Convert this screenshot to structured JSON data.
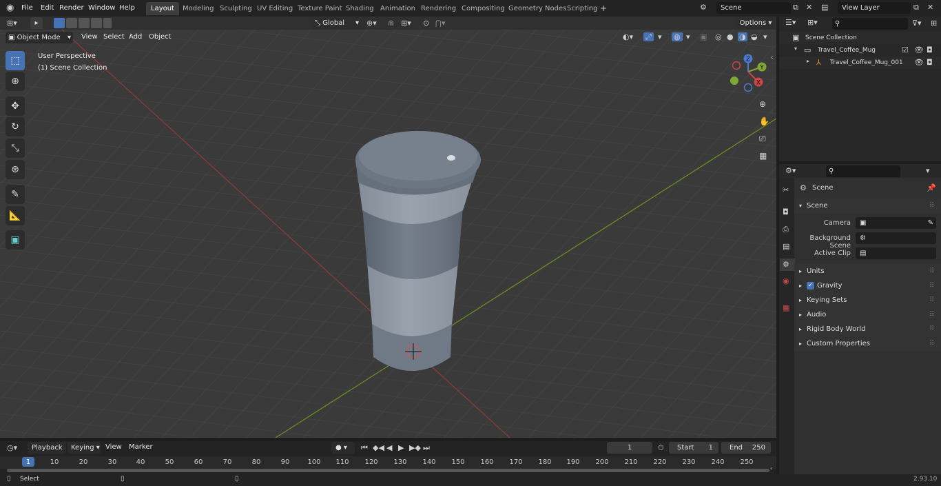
{
  "menus": [
    "File",
    "Edit",
    "Render",
    "Window",
    "Help"
  ],
  "workspaces": [
    "Layout",
    "Modeling",
    "Sculpting",
    "UV Editing",
    "Texture Paint",
    "Shading",
    "Animation",
    "Rendering",
    "Compositing",
    "Geometry Nodes",
    "Scripting"
  ],
  "active_workspace": "Layout",
  "scene_field": "Scene",
  "view_layer_field": "View Layer",
  "viewport": {
    "mode": "Object Mode",
    "menu": [
      "View",
      "Select",
      "Add",
      "Object"
    ],
    "transform_orientation": "Global",
    "options_label": "Options",
    "overlay_title": "User Perspective",
    "overlay_collection": "(1) Scene Collection",
    "gizmo_axes": {
      "x": "X",
      "y": "Y",
      "z": "Z"
    }
  },
  "outliner": {
    "root": "Scene Collection",
    "items": [
      {
        "label": "Travel_Coffee_Mug"
      },
      {
        "label": "Travel_Coffee_Mug_001"
      }
    ]
  },
  "properties": {
    "breadcrumb": "Scene",
    "panel_title": "Scene",
    "camera_label": "Camera",
    "background_label": "Background Scene",
    "clip_label": "Active Clip",
    "subpanels": [
      "Units",
      "Gravity",
      "Keying Sets",
      "Audio",
      "Rigid Body World",
      "Custom Properties"
    ],
    "gravity_checked": true
  },
  "timeline": {
    "menu": [
      "Playback",
      "Keying",
      "View",
      "Marker"
    ],
    "current_frame": "1",
    "start_label": "Start",
    "start_value": "1",
    "end_label": "End",
    "end_value": "250",
    "ruler": [
      "1",
      "10",
      "20",
      "30",
      "40",
      "50",
      "60",
      "70",
      "80",
      "90",
      "100",
      "110",
      "120",
      "130",
      "140",
      "150",
      "160",
      "170",
      "180",
      "190",
      "200",
      "210",
      "220",
      "230",
      "240",
      "250"
    ]
  },
  "status": {
    "left": "Select",
    "version": "2.93.10"
  },
  "colors": {
    "accent": "#4772b3",
    "x_axis": "#8b3a3a",
    "y_axis": "#6b8c21",
    "frame_marker": "#4772b3"
  }
}
